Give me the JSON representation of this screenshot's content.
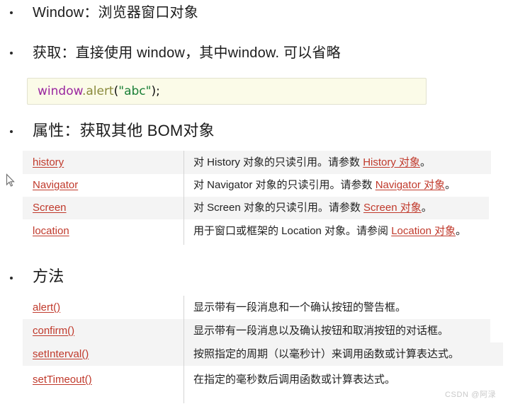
{
  "page": {
    "background": "#ffffff",
    "link_color": "#c0392b",
    "shade_color": "#f4f4f4",
    "code_bg": "#fbfbe8"
  },
  "sections": [
    {
      "bullet": "•",
      "text": "Window：浏览器窗口对象"
    },
    {
      "bullet": "•",
      "text": "获取：直接使用 window，其中window. 可以省略"
    },
    {
      "bullet": "•",
      "text": "属性：获取其他 BOM对象"
    },
    {
      "bullet": "•",
      "text": "方法"
    }
  ],
  "code_sample": {
    "object": "window",
    "dot_method": ".alert",
    "open_paren": "(",
    "string": "\"abc\"",
    "close_paren": ")",
    "semicolon": ";"
  },
  "properties_table": {
    "rows": [
      {
        "name": "history",
        "desc_prefix": "对 History 对象的只读引用。请参数 ",
        "desc_link": "History 对象",
        "desc_suffix": "。",
        "shaded": true
      },
      {
        "name": "Navigator",
        "desc_prefix": "对 Navigator 对象的只读引用。请参数 ",
        "desc_link": "Navigator 对象",
        "desc_suffix": "。",
        "shaded": false
      },
      {
        "name": "Screen",
        "desc_prefix": "对 Screen 对象的只读引用。请参数 ",
        "desc_link": "Screen 对象",
        "desc_suffix": "。",
        "shaded": true
      },
      {
        "name": "location",
        "desc_prefix": "用于窗口或框架的 Location 对象。请参阅 ",
        "desc_link": "Location 对象",
        "desc_suffix": "。",
        "shaded": false
      }
    ]
  },
  "methods_table": {
    "rows": [
      {
        "name": "alert()",
        "desc_prefix": "显示带有一段消息和一个确认按钮的警告框。",
        "desc_link": "",
        "desc_suffix": "",
        "shaded": false
      },
      {
        "name": "confirm()",
        "desc_prefix": "显示带有一段消息以及确认按钮和取消按钮的对话框。",
        "desc_link": "",
        "desc_suffix": "",
        "shaded": true
      },
      {
        "name": "setInterval()",
        "desc_prefix": "按照指定的周期（以毫秒计）来调用函数或计算表达式。",
        "desc_link": "",
        "desc_suffix": "",
        "shaded": true
      },
      {
        "name": "setTimeout()",
        "desc_prefix": "在指定的毫秒数后调用函数或计算表达式。",
        "desc_link": "",
        "desc_suffix": "",
        "shaded": false
      }
    ]
  },
  "watermark": {
    "text": "CSDN @阿渌"
  },
  "cursor": {
    "name": "mouse-pointer"
  }
}
